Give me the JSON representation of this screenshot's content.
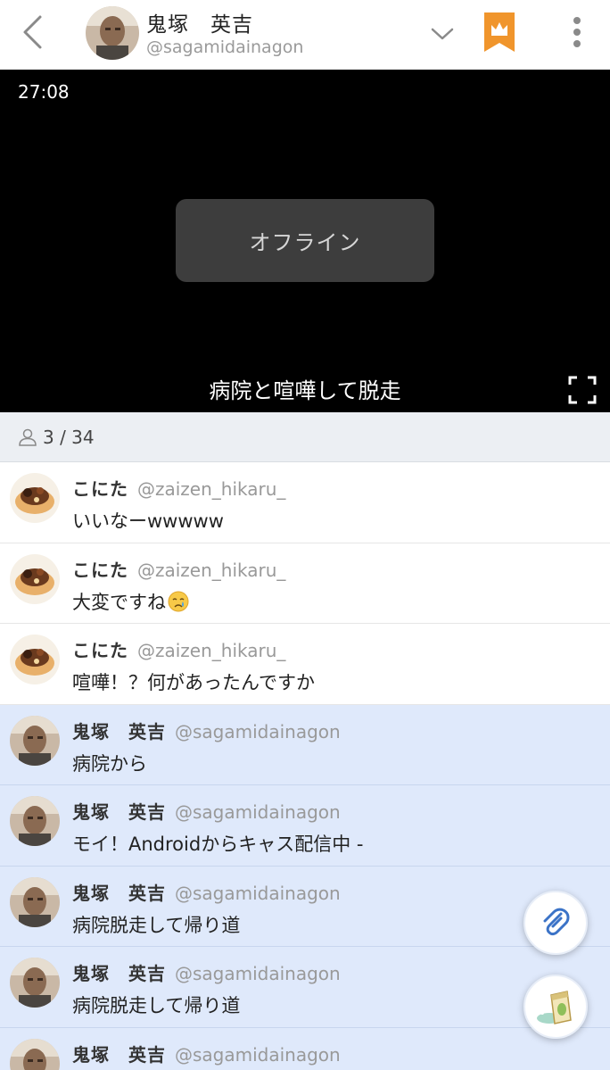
{
  "header": {
    "back_icon": "chevron-left-icon",
    "owner_name": "鬼塚　英吉",
    "owner_handle": "@sagamidainagon",
    "dropdown_icon": "chevron-down-icon",
    "bookmark_icon": "crown-bookmark-icon",
    "more_icon": "more-vertical-icon",
    "accent_color": "#f0952c"
  },
  "video": {
    "elapsed": "27:08",
    "status": "オフライン",
    "title": "病院と喧嘩して脱走",
    "fullscreen_icon": "fullscreen-icon"
  },
  "viewers": {
    "icon": "person-icon",
    "count": "3 / 34"
  },
  "comments": [
    {
      "name": "こにた",
      "handle": "@zaizen_hikaru_",
      "text": "いいなーwwwww",
      "mine": false
    },
    {
      "name": "こにた",
      "handle": "@zaizen_hikaru_",
      "text": "大変ですね",
      "emoji": "crying-face",
      "mine": false
    },
    {
      "name": "こにた",
      "handle": "@zaizen_hikaru_",
      "text": "喧嘩！？何があったんですか",
      "mine": false
    },
    {
      "name": "鬼塚　英吉",
      "handle": "@sagamidainagon",
      "text": "病院から",
      "mine": true
    },
    {
      "name": "鬼塚　英吉",
      "handle": "@sagamidainagon",
      "text": "モイ！Androidからキャス配信中 -",
      "mine": true
    },
    {
      "name": "鬼塚　英吉",
      "handle": "@sagamidainagon",
      "text": "病院脱走して帰り道",
      "mine": true
    },
    {
      "name": "鬼塚　英吉",
      "handle": "@sagamidainagon",
      "text": "病院脱走して帰り道",
      "mine": true
    },
    {
      "name": "鬼塚　英吉",
      "handle": "@sagamidainagon",
      "text": "",
      "mine": true
    }
  ],
  "fabs": {
    "attach_icon": "paperclip-icon",
    "gift_icon": "tea-gift-icon"
  }
}
